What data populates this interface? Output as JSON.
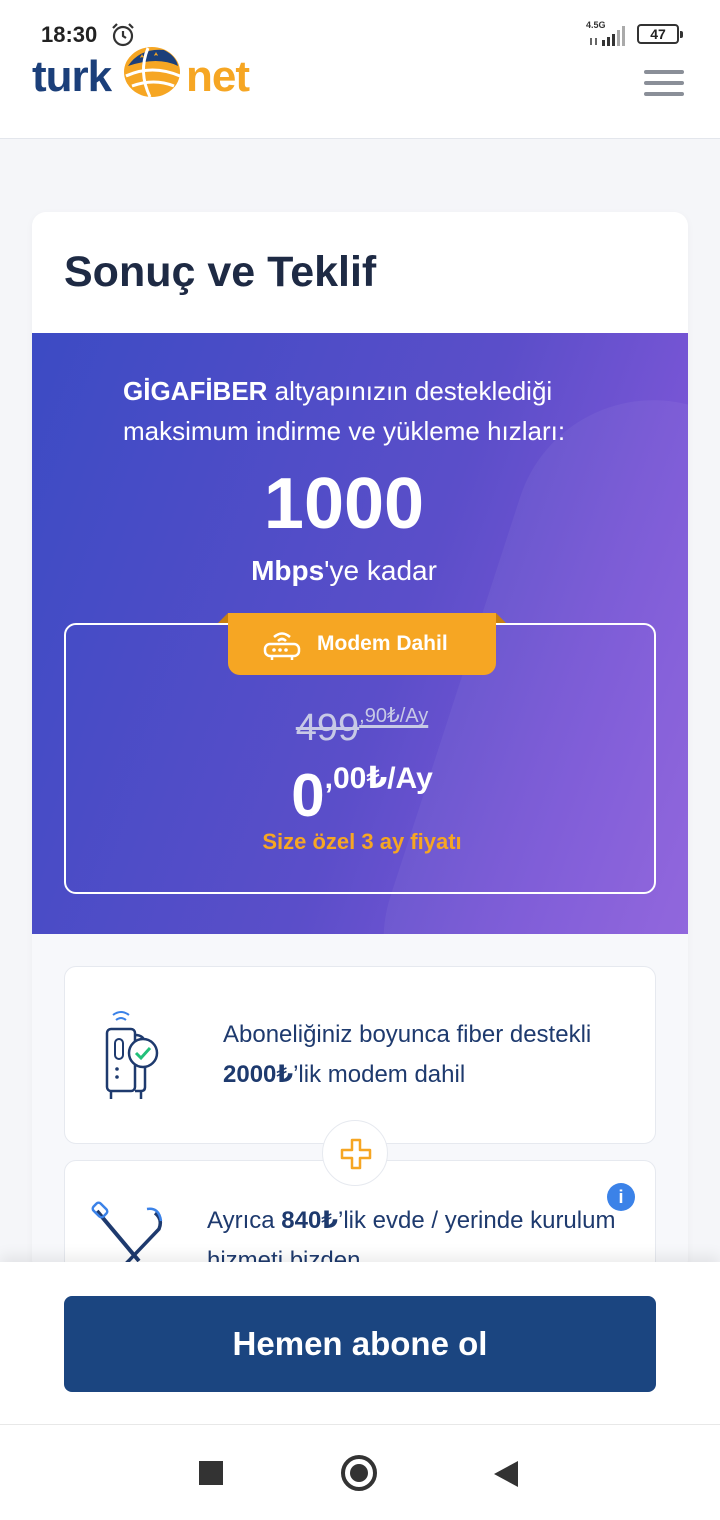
{
  "status_bar": {
    "time": "18:30",
    "network": "4.5G",
    "battery": "47"
  },
  "header": {
    "logo_turk": "turk",
    "logo_net": "net",
    "menu_icon": "hamburger-menu-icon"
  },
  "card": {
    "title": "Sonuç ve Teklif",
    "hero": {
      "intro_brand": "GİGAFİBER",
      "intro_rest": " altyapınızın desteklediği maksimum indirme ve yükleme hızları:",
      "speed_value": "1000",
      "speed_unit_bold": "Mbps",
      "speed_unit_rest": "'ye kadar"
    },
    "offer": {
      "tag_label": "Modem Dahil",
      "old_price_main": "499",
      "old_price_sup": ",90₺/Ay",
      "new_price_main": "0",
      "new_price_sup": ",00₺/Ay",
      "note": "Size özel 3 ay fiyatı"
    },
    "features": [
      {
        "text_before": "Aboneliğiniz boyunca fiber destekli ",
        "text_bold": "2000₺",
        "text_after": "’lik modem dahil",
        "icon": "modem-illustration-icon"
      },
      {
        "text_before": "Ayrıca ",
        "text_bold": "840₺",
        "text_after": "’lik evde / yerinde kurulum hizmeti bizden",
        "icon": "tools-illustration-icon",
        "info": "i"
      }
    ]
  },
  "cta": {
    "label": "Hemen abone ol"
  },
  "colors": {
    "brand_blue": "#1b4580",
    "brand_orange": "#f6a623",
    "hero_gradient_start": "#3c4bc4",
    "hero_gradient_end": "#8c5fdc"
  }
}
